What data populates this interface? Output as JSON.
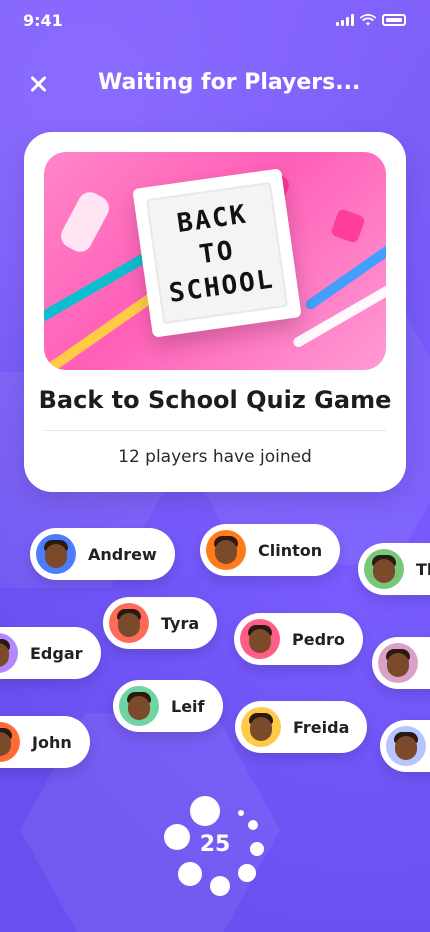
{
  "status_bar": {
    "time": "9:41"
  },
  "header": {
    "title": "Waiting for Players..."
  },
  "quiz": {
    "image_board_lines": [
      "BACK",
      "TO",
      "SCHOOL"
    ],
    "title": "Back to School Quiz Game",
    "joined_text": "12 players have joined"
  },
  "players": [
    {
      "name": "Andrew",
      "avatar_bg": "#4c7dff"
    },
    {
      "name": "Clinton",
      "avatar_bg": "#ff7a1a"
    },
    {
      "name": "Th",
      "avatar_bg": "#77c97a"
    },
    {
      "name": "Tyra",
      "avatar_bg": "#ff6b5a"
    },
    {
      "name": "Pedro",
      "avatar_bg": "#ff5f86"
    },
    {
      "name": "Edgar",
      "avatar_bg": "#b388ff"
    },
    {
      "name": "Leif",
      "avatar_bg": "#6fd3a2"
    },
    {
      "name": "Freida",
      "avatar_bg": "#ffc94a"
    },
    {
      "name": "John",
      "avatar_bg": "#ff6b35"
    },
    {
      "name": "",
      "avatar_bg": "#d9a1c8"
    },
    {
      "name": "",
      "avatar_bg": "#b8c4ff"
    }
  ],
  "timer": {
    "value": "25"
  },
  "colors": {
    "bg_primary": "#6a4ff0",
    "card": "#ffffff",
    "text_dark": "#1d1d1f"
  },
  "icons": {
    "close": "close-icon",
    "signal": "cellular-signal-icon",
    "wifi": "wifi-icon",
    "battery": "battery-icon"
  }
}
